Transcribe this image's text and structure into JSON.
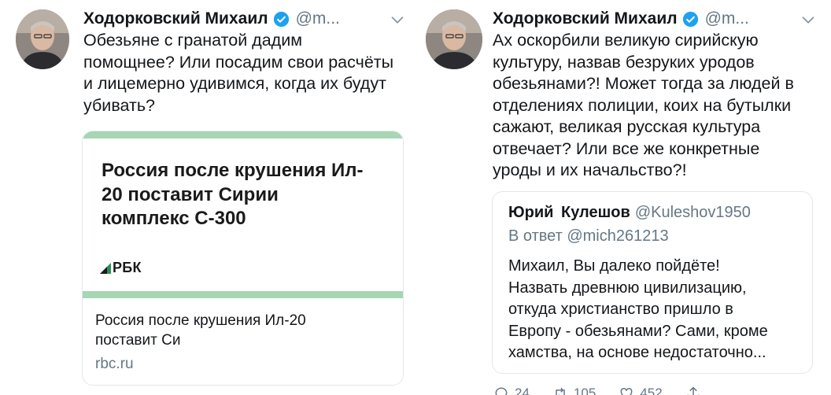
{
  "tweets": [
    {
      "author": {
        "name": "Ходорковский Михаил",
        "handle": "@m..."
      },
      "text": "Обезьяне с гранатой дадим\nпомощнее? Или посадим свои расчёты\nи лицемерно удивимся, когда их будут\nубивать?",
      "card": {
        "headline": "Россия после крушения Ил-\n20 поставит Сирии\nкомплекс С-300",
        "logo_text": "РБК",
        "title": "Россия после крушения Ил-20\nпоставит Си",
        "domain": "rbc.ru"
      }
    },
    {
      "author": {
        "name": "Ходорковский Михаил",
        "handle": "@m..."
      },
      "text": "Ах оскорбили великую сирийскую\nкультуру, назвав безруких уродов\nобезьянами?! Может тогда за людей в\nотделениях полиции, коих на бутылки\nсажают, великая русская культура\nотвечает? Или все же конкретные\nуроды и их начальство?!",
      "quote": {
        "name": "Юрий  Кулешов",
        "handle": "@Kuleshov1950",
        "reply_to": "В ответ @mich261213",
        "text": "Михаил, Вы далеко пойдёте!\nНазвать древнюю цивилизацию,\nоткуда христианство пришло в\nЕвропу - обезьянами? Сами, кроме\nхамства, на основе недостаточно..."
      },
      "actions": {
        "replies": "24",
        "retweets": "105",
        "likes": "452"
      }
    }
  ],
  "colors": {
    "verified": "#1da1f2",
    "secondary_text": "#657786",
    "card_accent": "#a6d6b3",
    "border": "#e1e8ed"
  },
  "icons": {
    "verified": "verified-badge-icon",
    "caret": "chevron-down-icon",
    "reply": "reply-icon",
    "retweet": "retweet-icon",
    "like": "heart-icon",
    "share": "share-icon"
  }
}
